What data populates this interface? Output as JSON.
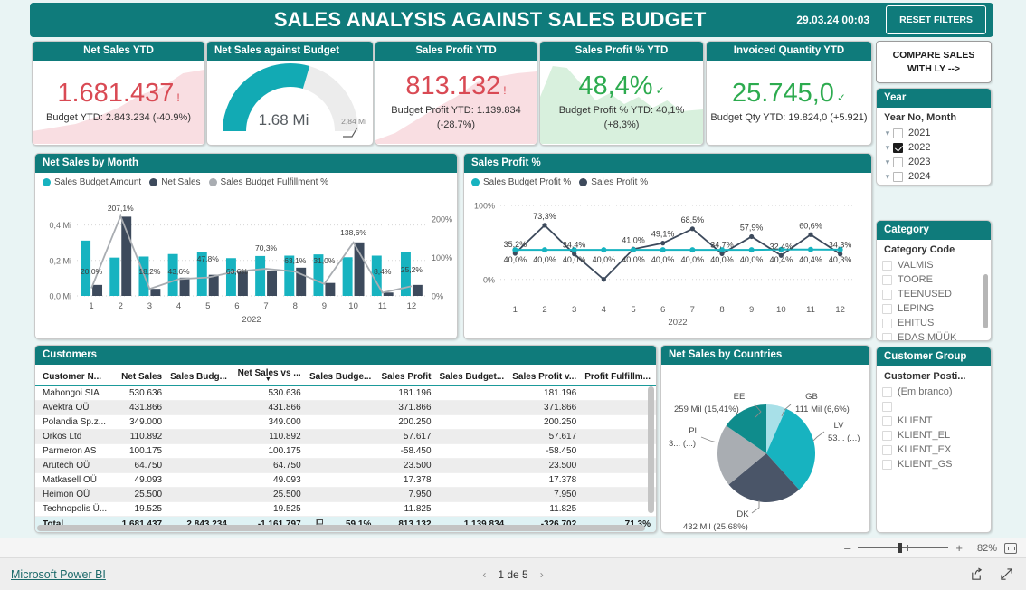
{
  "header": {
    "title": "SALES ANALYSIS AGAINST SALES BUDGET",
    "date": "29.03.24 00:03",
    "reset_label": "RESET FILTERS"
  },
  "kpis": [
    {
      "title": "Net Sales YTD",
      "value": "1.681.437",
      "mark": "!",
      "sub": "Budget YTD: 2.843.234 (-40.9%)",
      "tone": "red"
    },
    {
      "title": "Sales Profit YTD",
      "value": "813.132",
      "mark": "!",
      "sub_line1": "Budget Profit YTD: 1.139.834",
      "sub_line2": "(-28.7%)",
      "tone": "red"
    },
    {
      "title": "Sales Profit % YTD",
      "value": "48,4%",
      "mark": "✓",
      "sub_line1": "Budget Profit % YTD: 40,1%",
      "sub_line2": "(+8,3%)",
      "tone": "green"
    },
    {
      "title": "Invoiced Quantity YTD",
      "value": "25.745,0",
      "mark": "✓",
      "sub": "Budget Qty YTD: 19.824,0 (+5.921)",
      "tone": "green"
    }
  ],
  "gauge": {
    "title": "Net Sales against Budget",
    "value_label": "1.68 Mi",
    "max_label": "2,84 Mi",
    "value": 1.681437,
    "max": 2.843234
  },
  "compare_button": {
    "line1": "COMPARE SALES",
    "line2": "WITH LY -->"
  },
  "year_slicer": {
    "title": "Year",
    "subtitle": "Year No, Month",
    "items": [
      {
        "label": "2021",
        "checked": false
      },
      {
        "label": "2022",
        "checked": true
      },
      {
        "label": "2023",
        "checked": false
      },
      {
        "label": "2024",
        "checked": false
      }
    ]
  },
  "category_slicer": {
    "title": "Category",
    "subtitle": "Category Code",
    "items": [
      {
        "label": "VALMIS",
        "checked": false
      },
      {
        "label": "TOORE",
        "checked": false
      },
      {
        "label": "TEENUSED",
        "checked": false
      },
      {
        "label": "LEPING",
        "checked": false
      },
      {
        "label": "EHITUS",
        "checked": false
      },
      {
        "label": "EDASIMÜÜK",
        "checked": false
      }
    ]
  },
  "customer_group_slicer": {
    "title": "Customer Group",
    "subtitle": "Customer Posti...",
    "items": [
      {
        "label": "(Em branco)",
        "checked": false
      },
      {
        "label": "",
        "checked": false
      },
      {
        "label": "KLIENT",
        "checked": false
      },
      {
        "label": "KLIENT_EL",
        "checked": false
      },
      {
        "label": "KLIENT_EX",
        "checked": false
      },
      {
        "label": "KLIENT_GS",
        "checked": false
      }
    ]
  },
  "customers_table": {
    "title": "Customers",
    "columns": [
      "Customer N...",
      "Net Sales",
      "Sales Budg...",
      "Net Sales vs ...",
      "Sales Budge...",
      "Sales Profit",
      "Sales Budget...",
      "Sales Profit v...",
      "Profit Fulfillm..."
    ],
    "sorted_column_index": 3,
    "rows": [
      [
        "Mahongoi SIA",
        "530.636",
        "",
        "530.636",
        "",
        "181.196",
        "",
        "181.196",
        ""
      ],
      [
        "Avektra OÜ",
        "431.866",
        "",
        "431.866",
        "",
        "371.866",
        "",
        "371.866",
        ""
      ],
      [
        "Polandia Sp.z...",
        "349.000",
        "",
        "349.000",
        "",
        "200.250",
        "",
        "200.250",
        ""
      ],
      [
        "Orkos Ltd",
        "110.892",
        "",
        "110.892",
        "",
        "57.617",
        "",
        "57.617",
        ""
      ],
      [
        "Parmeron AS",
        "100.175",
        "",
        "100.175",
        "",
        "-58.450",
        "",
        "-58.450",
        ""
      ],
      [
        "Arutech OÜ",
        "64.750",
        "",
        "64.750",
        "",
        "23.500",
        "",
        "23.500",
        ""
      ],
      [
        "Matkasell OÜ",
        "49.093",
        "",
        "49.093",
        "",
        "17.378",
        "",
        "17.378",
        ""
      ],
      [
        "Heimon OÜ",
        "25.500",
        "",
        "25.500",
        "",
        "7.950",
        "",
        "7.950",
        ""
      ],
      [
        "Technopolis Ü...",
        "19.525",
        "",
        "19.525",
        "",
        "11.825",
        "",
        "11.825",
        ""
      ]
    ],
    "total_row": {
      "label": "Total",
      "net_sales": "1.681.437",
      "sales_budget": "2.843.234",
      "net_sales_vs": "-1.161.797",
      "budget_fulfillment": "59,1%",
      "sales_profit": "813.132",
      "sales_budget_profit": "1.139.834",
      "sales_profit_vs": "-326.702",
      "profit_fulfillment": "71,3%"
    }
  },
  "net_sales_by_month": {
    "title": "Net Sales by Month",
    "legend": [
      {
        "label": "Sales Budget Amount",
        "color": "#17b3c0"
      },
      {
        "label": "Net Sales",
        "color": "#3d4a5c"
      },
      {
        "label": "Sales Budget Fulfillment %",
        "color": "#a9adb2"
      }
    ]
  },
  "sales_profit_pct": {
    "title": "Sales Profit %",
    "legend": [
      {
        "label": "Sales Budget Profit %",
        "color": "#17b3c0"
      },
      {
        "label": "Sales Profit %",
        "color": "#3d4a5c"
      }
    ]
  },
  "pie_card": {
    "title": "Net Sales by Countries"
  },
  "zoom_control": {
    "minus": "–",
    "plus": "+",
    "percent": "82%"
  },
  "footer": {
    "brand": "Microsoft Power BI",
    "page_label": "1 de 5",
    "prev": "‹",
    "next": "›"
  },
  "chart_data": [
    {
      "type": "bar",
      "id": "net-sales-by-month",
      "title": "Net Sales by Month",
      "xlabel": "2022",
      "ylabel": "",
      "categories": [
        "1",
        "2",
        "3",
        "4",
        "5",
        "6",
        "7",
        "8",
        "9",
        "10",
        "11",
        "12"
      ],
      "ylim": [
        0,
        0.5
      ],
      "ytick_labels": [
        "0,0 Mi",
        "0,2 Mi",
        "0,4 Mi"
      ],
      "ytick_values": [
        0,
        0.2,
        0.4
      ],
      "y2lim": [
        0,
        230
      ],
      "y2tick_labels": [
        "0%",
        "100%",
        "200%"
      ],
      "y2tick_values": [
        0,
        100,
        200
      ],
      "grid": true,
      "legend_position": "top-left",
      "series": [
        {
          "name": "Sales Budget Amount",
          "color": "#17b3c0",
          "type": "bar",
          "values": [
            0.312,
            0.216,
            0.222,
            0.236,
            0.25,
            0.213,
            0.225,
            0.227,
            0.234,
            0.218,
            0.227,
            0.248
          ]
        },
        {
          "name": "Net Sales",
          "color": "#3d4a5c",
          "type": "bar",
          "values": [
            0.062,
            0.447,
            0.04,
            0.103,
            0.119,
            0.136,
            0.142,
            0.159,
            0.073,
            0.302,
            0.019,
            0.062
          ]
        },
        {
          "name": "Sales Budget Fulfillment %",
          "color": "#a9adb2",
          "type": "line",
          "axis": "secondary",
          "values": [
            20.0,
            207.1,
            18.2,
            43.6,
            47.8,
            63.6,
            70.3,
            63.1,
            31.0,
            138.6,
            8.4,
            25.2
          ],
          "data_labels": [
            "20,0%",
            "207,1%",
            "18,2%",
            "43,6%",
            "47,8%",
            "63,6%",
            "70,3%",
            "63,1%",
            "31,0%",
            "138,6%",
            "8,4%",
            "25,2%"
          ]
        }
      ]
    },
    {
      "type": "line",
      "id": "sales-profit-percent",
      "title": "Sales Profit %",
      "xlabel": "2022",
      "ylabel": "",
      "categories": [
        "1",
        "2",
        "3",
        "4",
        "5",
        "6",
        "7",
        "8",
        "9",
        "10",
        "11",
        "12"
      ],
      "ylim": [
        -15,
        105
      ],
      "ytick_labels": [
        "0%",
        "100%"
      ],
      "ytick_values": [
        0,
        100
      ],
      "grid": true,
      "legend_position": "top-left",
      "series": [
        {
          "name": "Sales Budget Profit %",
          "color": "#17b3c0",
          "values": [
            40.0,
            40.0,
            40.0,
            40.0,
            40.0,
            40.0,
            40.0,
            40.0,
            40.0,
            40.4,
            40.4,
            40.3
          ],
          "data_labels": [
            "40,0%",
            "40,0%",
            "40,0%",
            "40,0%",
            "40,0%",
            "40,0%",
            "40,0%",
            "40,0%",
            "40,0%",
            "40,4%",
            "40,4%",
            "40,3%"
          ]
        },
        {
          "name": "Sales Profit %",
          "color": "#3d4a5c",
          "values": [
            35.2,
            73.3,
            34.4,
            0.0,
            41.0,
            49.1,
            68.5,
            34.7,
            57.9,
            32.4,
            60.6,
            34.3
          ],
          "data_labels": [
            "35,2%",
            "73,3%",
            "34,4%",
            "",
            "41,0%",
            "49,1%",
            "68,5%",
            "34,7%",
            "57,9%",
            "32,4%",
            "60,6%",
            "34,3%"
          ]
        }
      ]
    },
    {
      "type": "pie",
      "id": "net-sales-by-countries",
      "title": "Net Sales by Countries",
      "slices": [
        {
          "label": "GB",
          "value": 6.6,
          "display": "111 Mil (6,6%)",
          "color": "#a8e0e8"
        },
        {
          "label": "LV",
          "value": 31.7,
          "display": "53... (...)",
          "color": "#17b3c0"
        },
        {
          "label": "DK",
          "value": 25.68,
          "display": "432 Mil (25,68%)",
          "color": "#4a5568"
        },
        {
          "label": "PL",
          "value": 20.6,
          "display": "3... (...)",
          "color": "#a9adb2"
        },
        {
          "label": "EE",
          "value": 15.41,
          "display": "259 Mil (15,41%)",
          "color": "#0f8c8c"
        }
      ]
    }
  ]
}
